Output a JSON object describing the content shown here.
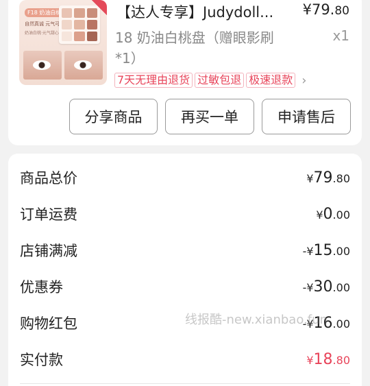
{
  "product": {
    "title": "【达人专享】Judydoll...",
    "price_int": "¥79.",
    "price_dec": "80",
    "sku": "18 奶油白桃盘（赠眼影刷*1）",
    "qty": "x1",
    "tags": [
      "7天无理由退货",
      "过敏包退",
      "极速退款"
    ],
    "chevron": "›",
    "thumb_texts": [
      "F18 奶油白桃盘",
      "自然真诚 元气可爱",
      "奶油白桃·元气甜心"
    ]
  },
  "actions": {
    "share": "分享商品",
    "rebuy": "再买一单",
    "aftersale": "申请售后"
  },
  "summary": [
    {
      "label": "商品总价",
      "prefix": "¥",
      "int": "79",
      "dec": ".80",
      "red": false
    },
    {
      "label": "订单运费",
      "prefix": "¥",
      "int": "0",
      "dec": ".00",
      "red": false
    },
    {
      "label": "店铺满减",
      "prefix": "-¥",
      "int": "15",
      "dec": ".00",
      "red": false
    },
    {
      "label": "优惠券",
      "prefix": "-¥",
      "int": "30",
      "dec": ".00",
      "red": false
    },
    {
      "label": "购物红包",
      "prefix": "-¥",
      "int": "16",
      "dec": ".00",
      "red": false
    },
    {
      "label": "实付款",
      "prefix": "¥",
      "int": "18",
      "dec": ".80",
      "red": true
    }
  ],
  "watermark": "线报酷-new.xianbao.fun",
  "colors": {
    "accent": "#e8445a",
    "text": "#222222",
    "muted": "#888888"
  }
}
